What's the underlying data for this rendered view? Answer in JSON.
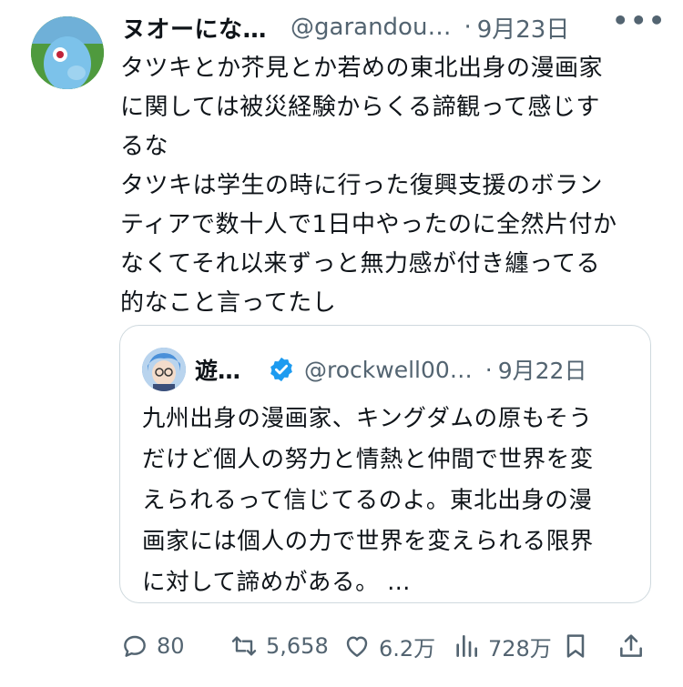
{
  "tweet": {
    "author_name": "ヌオーにな…",
    "handle": "@garandou…",
    "separator": "·",
    "date": "9月23日",
    "more_label": "•••",
    "text": "タツキとか芥見とか若めの東北出身の漫画家\nに関しては被災経験からくる諦観って感じす\nるな\nタツキは学生の時に行った復興支援のボラン\nティアで数十人で1日中やったのに全然片付か\nなくてそれ以来ずっと無力感が付き纏ってる\n的なこと言ってたし"
  },
  "quote": {
    "author_name": "遊…",
    "handle": "@rockwell00…",
    "separator": "·",
    "date": "9月22日",
    "text": "九州出身の漫画家、キングダムの原もそう\nだけど個人の努力と情熱と仲間で世界を変\nえられるって信じてるのよ。東北出身の漫\n画家には個人の力で世界を変えられる限界\nに対して諦めがある。 …"
  },
  "actions": {
    "replies": "80",
    "retweets": "5,658",
    "likes": "6.2万",
    "views": "728万"
  },
  "colors": {
    "text_primary": "#0f1419",
    "text_secondary": "#536471",
    "border": "#cfd9de",
    "verified": "#1d9bf0"
  },
  "icons": [
    "reply-icon",
    "retweet-icon",
    "like-icon",
    "views-icon",
    "bookmark-icon",
    "share-icon",
    "verified-icon"
  ]
}
